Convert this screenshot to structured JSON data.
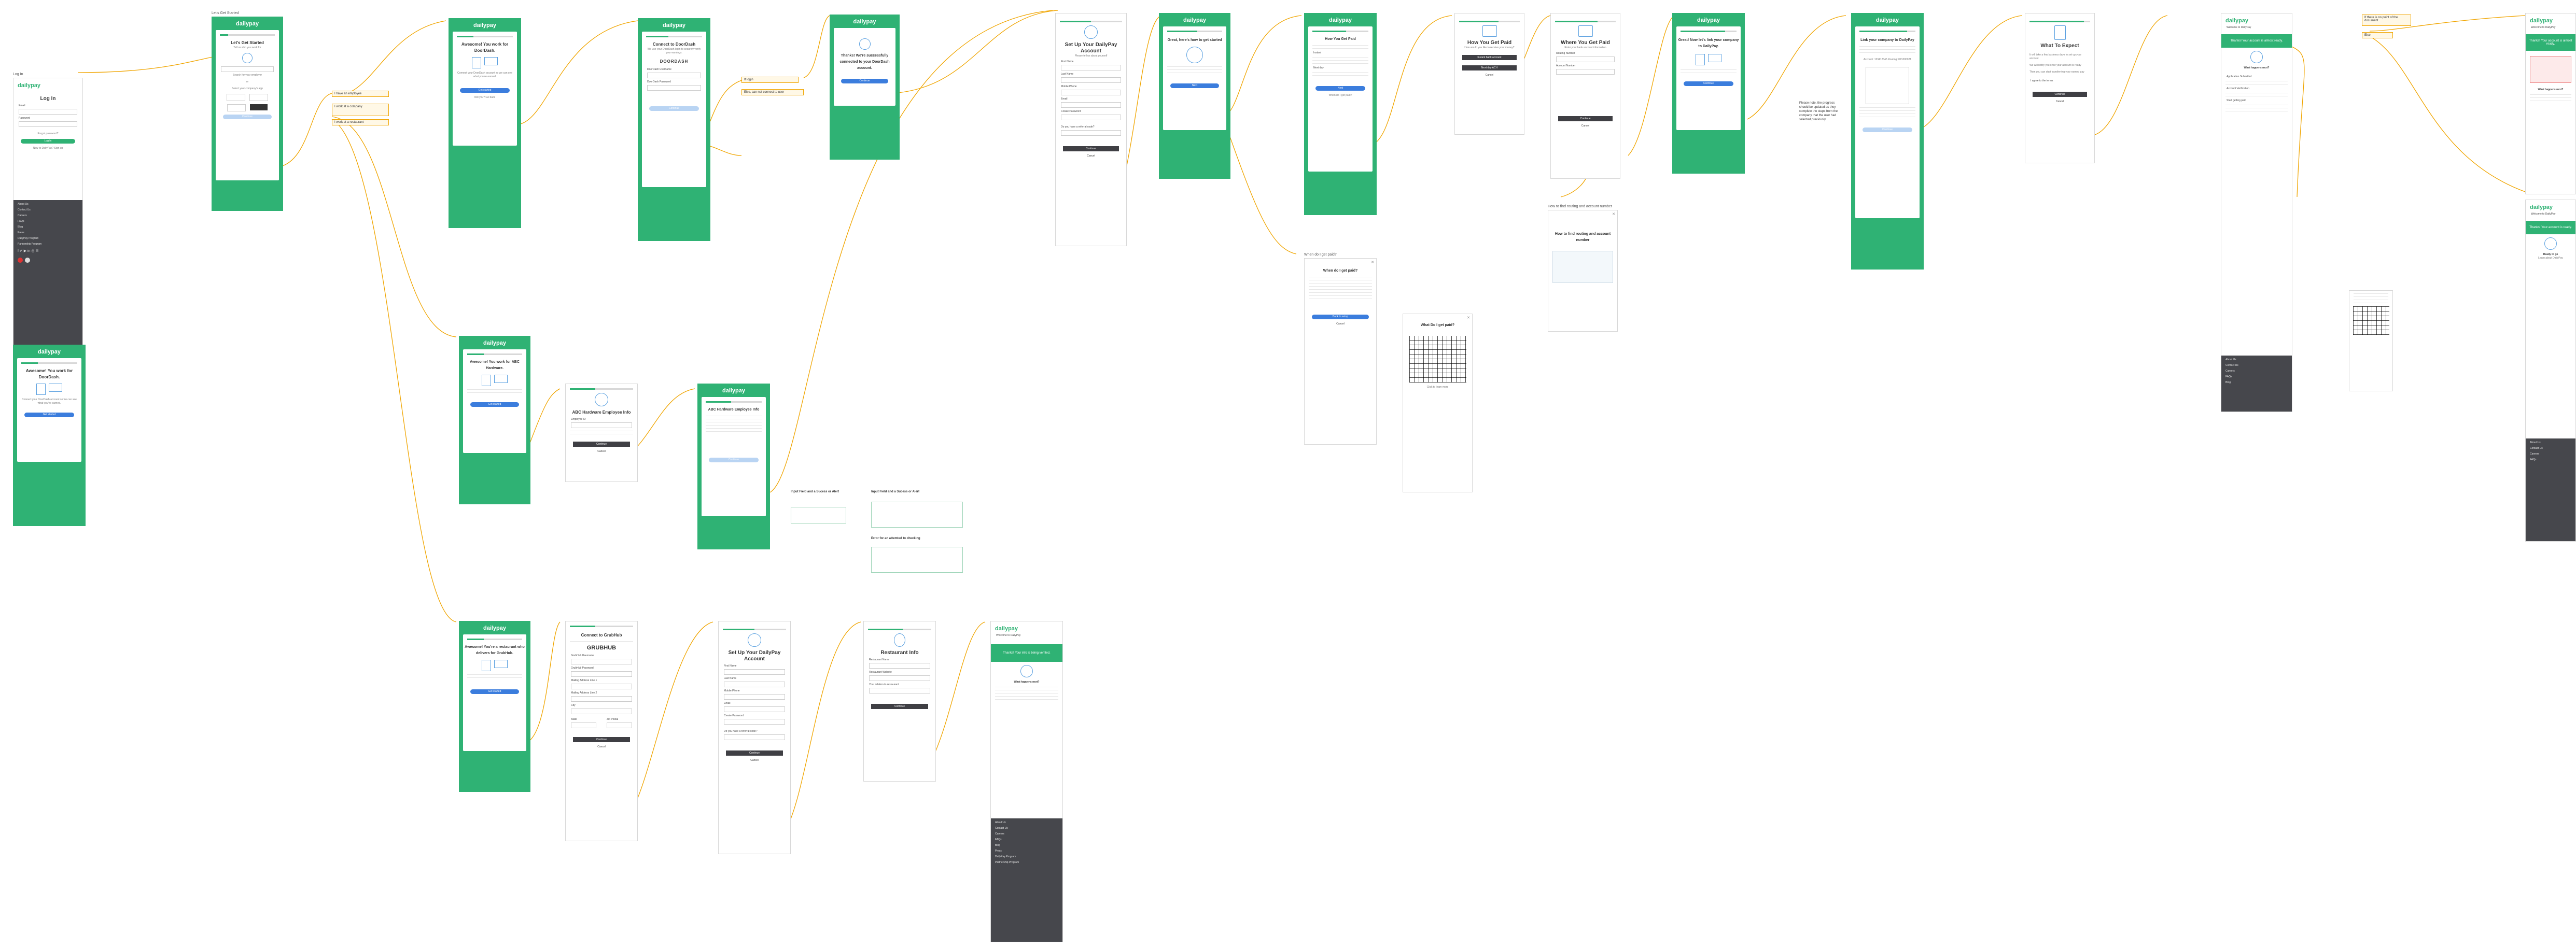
{
  "brand": "dailypay",
  "labels": {
    "login_frame": "Log In",
    "tell_us_frame": "Let's Get Started",
    "choice_a": "I have an employee",
    "choice_b": "I work at a company",
    "choice_c": "I work at a restaurant",
    "dd_frame": "Connect to DoorDash",
    "dd_connecting": "We could not find your employer",
    "dd_success": "Thanks! We're connecting to your account",
    "acct_frame": "Set Up Your DailyPay Account",
    "howpaid_frame": "How You Get Paid",
    "bank_frame": "Where You Get Paid",
    "direct_frame": "Enroll now",
    "expect_frame": "What To Expect",
    "welcome_frame": "Welcome to DailyPay",
    "abc_frame": "ABC Hardware Employee Info",
    "grubhub_frame": "Connect to GrubHub",
    "rest_frame": "Restaurant Info",
    "when_frame": "When do I get paid?",
    "routing_frame": "How to find routing and account number",
    "check_frame": "What Do I get paid?"
  },
  "login": {
    "title": "Log In",
    "user_label": "Email",
    "pass_label": "Password",
    "forgot": "Forgot password?",
    "button": "Log In",
    "signup": "New to DailyPay? Sign up"
  },
  "footer": {
    "items": [
      "About Us",
      "Contact Us",
      "Careers",
      "FAQs",
      "Blog",
      "Press",
      "DailyPay Program",
      "Partnership Program"
    ]
  },
  "start": {
    "title": "Let's Get Started",
    "subtitle": "Tell us who you work for",
    "employer_placeholder": "Search for your employer",
    "or": "or",
    "select_text": "Select your company's app",
    "button": "Continue"
  },
  "awesome_dd": {
    "title": "Awesome! You work for DoorDash.",
    "text": "Connect your DoorDash account so we can see what you've earned.",
    "button": "Get started",
    "link": "Not you? Go back"
  },
  "awesome_dd2": {
    "title": "Awesome! You work for DoorDash.",
    "text": "Connect your DoorDash account so we can see what you've earned.",
    "button": "Get started"
  },
  "connect_dd": {
    "title": "Connect to DoorDash",
    "text": "We use your DoorDash login to securely verify your earnings.",
    "logo": "DOORDASH",
    "email_label": "DoorDash Username",
    "pass_label": "DoorDash Password",
    "button": "Continue"
  },
  "dd_notes": {
    "a": "If login",
    "b": "Else, can not connect to user"
  },
  "connected": {
    "title": "Thanks! We're successfully connected to your DoorDash account.",
    "button": "Continue"
  },
  "setup": {
    "title": "Set Up Your DailyPay Account",
    "text": "Please tell us about yourself",
    "fields": [
      "First Name",
      "Last Name",
      "Mobile Phone",
      "Email",
      "Create Password"
    ],
    "question": "Do you have a referral code?",
    "button": "Continue",
    "cancel": "Cancel"
  },
  "heres_how": {
    "title": "Great, here's how to get started",
    "button": "Next"
  },
  "how_paid": {
    "title": "How You Get Paid",
    "options": [
      "Instant",
      "Next day"
    ],
    "button": "Next",
    "link": "When do I get paid?"
  },
  "paid_white": {
    "title": "How You Get Paid",
    "text": "How would you like to receive your money?",
    "btn_a": "Instant bank account",
    "btn_b": "Next day ACH",
    "cancel": "Cancel"
  },
  "where_paid": {
    "title": "Where You Get Paid",
    "text": "Enter your bank account information",
    "fields": [
      "Routing Number",
      "Account Number"
    ],
    "button": "Continue",
    "cancel": "Cancel"
  },
  "enroll": {
    "title": "Great! Now let's link your company to DailyPay.",
    "button": "Continue"
  },
  "enroll_note": "Please note, the progress should be updated as they complete the steps from the company that the user had selected previously.",
  "link_company": {
    "title": "Link your company to DailyPay",
    "ids": "Account: 123412345 Routing: 021000021",
    "button": "Continue"
  },
  "expect": {
    "title": "What To Expect",
    "items": [
      "It will take a few business days to set up your account",
      "We will notify you once your account is ready",
      "Then you can start transferring your earned pay"
    ],
    "agree": "I agree to the terms",
    "button": "Continue",
    "cancel": "Cancel"
  },
  "welcome": {
    "title": "Welcome to DailyPay",
    "banner": "Thanks! Your account is almost ready.",
    "what_next": "What happens next?",
    "steps": [
      "Application Submitted",
      "Account Verification",
      "Start getting paid"
    ]
  },
  "side_notes": {
    "a": "If there is no point of the document",
    "b": "Else"
  },
  "welcome2": {
    "title": "Welcome to DailyPay",
    "banner": "Thanks! Your account is almost ready.",
    "what_next": "What happens next?"
  },
  "welcome3": {
    "title": "Welcome to DailyPay",
    "banner": "Thanks! Your account is ready.",
    "sub": "Ready to go",
    "link": "Learn about DailyPay"
  },
  "abc_awesome": {
    "title": "Awesome! You work for ABC Hardware.",
    "button": "Get started"
  },
  "abc_info": {
    "title": "ABC Hardware Employee Info",
    "field": "Employee ID",
    "button": "Continue",
    "cancel": "Cancel"
  },
  "abc_info2": {
    "title": "ABC Hardware Employee Info",
    "button": "Continue"
  },
  "abc_notes": {
    "a": "Input Field and a Sucess or Alert ",
    "b": "Input Field and a Sucess or Alert",
    "c": "Error for an attemted to checking"
  },
  "gh_awesome": {
    "title": "Awesome! You're a restaurant who delivers for GrubHub.",
    "button": "Get started"
  },
  "gh_connect": {
    "title": "Connect to GrubHub",
    "logo": "GRUBHUB",
    "fields": [
      "GrubHub Username",
      "GrubHub Password",
      "Mailing Address Line 1",
      "Mailing Address Line 2",
      "City",
      "State",
      "Zip Postal"
    ],
    "button": "Continue",
    "cancel": "Cancel"
  },
  "gh_setup": {
    "title": "Set Up Your DailyPay Account",
    "fields": [
      "First Name",
      "Last Name",
      "Mobile Phone",
      "Email",
      "Create Password"
    ],
    "question": "Do you have a referral code?",
    "button": "Continue",
    "cancel": "Cancel"
  },
  "rest_info": {
    "title": "Restaurant Info",
    "fields": [
      "Restaurant Name",
      "Restaurant Website",
      "Your relation to restaurant"
    ],
    "button": "Continue"
  },
  "rest_welcome": {
    "title": "Welcome to DailyPay",
    "banner": "Thanks! Your info is being verified.",
    "what_next": "What happens next?"
  },
  "when_paid": {
    "title": "When do I get paid?",
    "button": "Back to setup",
    "cancel": "Cancel"
  },
  "routing_help": {
    "title": "How to find routing and account number"
  },
  "check": {
    "title": "What Do I get paid?",
    "caption": "Click to learn more"
  }
}
